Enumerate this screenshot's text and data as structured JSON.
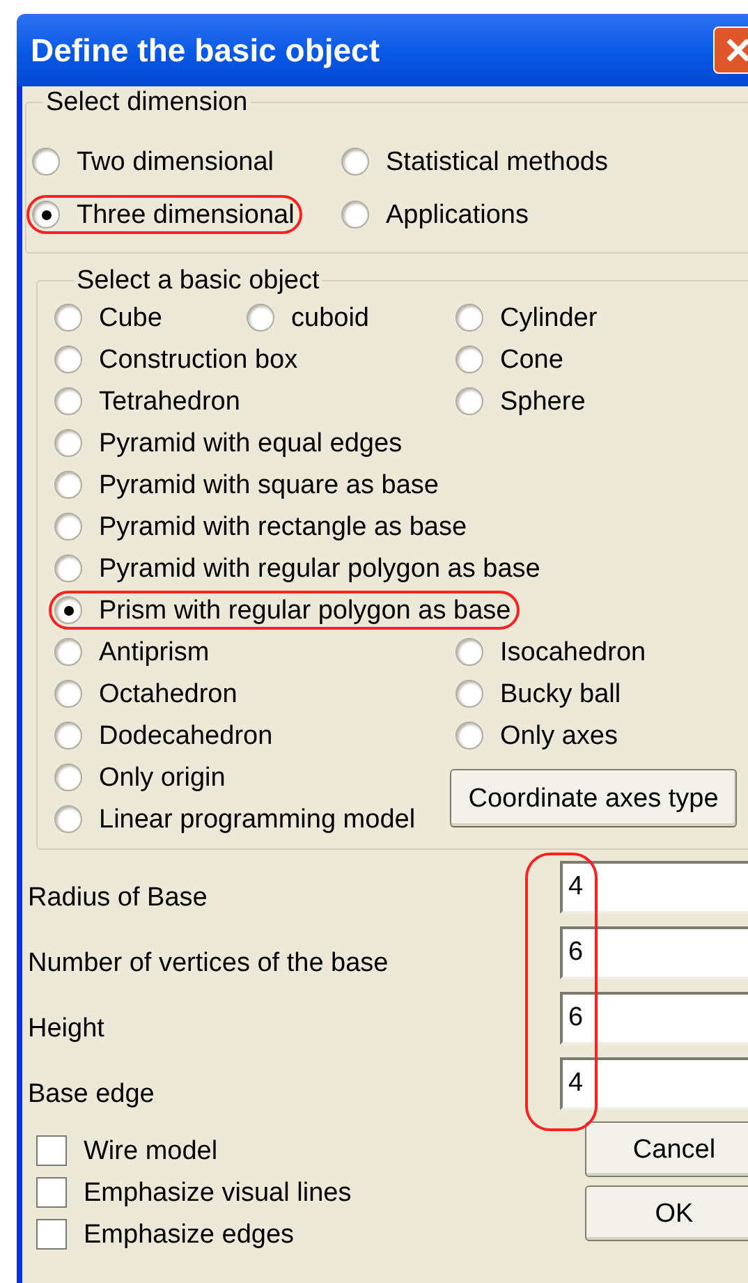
{
  "window": {
    "title": "Define the basic object"
  },
  "dimension_group": {
    "title": "Select dimension",
    "options": [
      {
        "label": "Two dimensional",
        "selected": false,
        "circled": false
      },
      {
        "label": "Statistical methods",
        "selected": false,
        "circled": false
      },
      {
        "label": "Three dimensional",
        "selected": true,
        "circled": true
      },
      {
        "label": "Applications",
        "selected": false,
        "circled": false
      }
    ]
  },
  "object_group": {
    "title": "Select a basic object",
    "rows": [
      {
        "left": {
          "label": "Cube",
          "selected": false,
          "circled": false
        },
        "middle": {
          "label": "cuboid",
          "selected": false,
          "circled": false
        },
        "right": {
          "label": "Cylinder",
          "selected": false,
          "circled": false
        }
      },
      {
        "left": {
          "label": "Construction box",
          "selected": false,
          "circled": false
        },
        "right": {
          "label": "Cone",
          "selected": false,
          "circled": false
        }
      },
      {
        "left": {
          "label": "Tetrahedron",
          "selected": false,
          "circled": false
        },
        "right": {
          "label": "Sphere",
          "selected": false,
          "circled": false
        }
      },
      {
        "left": {
          "label": "Pyramid with equal edges",
          "selected": false,
          "circled": false
        }
      },
      {
        "left": {
          "label": "Pyramid with square as base",
          "selected": false,
          "circled": false
        }
      },
      {
        "left": {
          "label": "Pyramid with rectangle as base",
          "selected": false,
          "circled": false
        }
      },
      {
        "left": {
          "label": "Pyramid with regular polygon as base",
          "selected": false,
          "circled": false
        }
      },
      {
        "left": {
          "label": "Prism with regular polygon as base",
          "selected": true,
          "circled": true
        }
      },
      {
        "left": {
          "label": "Antiprism",
          "selected": false,
          "circled": false
        },
        "right": {
          "label": "Isocahedron",
          "selected": false,
          "circled": false
        }
      },
      {
        "left": {
          "label": "Octahedron",
          "selected": false,
          "circled": false
        },
        "right": {
          "label": "Bucky ball",
          "selected": false,
          "circled": false
        }
      },
      {
        "left": {
          "label": "Dodecahedron",
          "selected": false,
          "circled": false
        },
        "right": {
          "label": "Only axes",
          "selected": false,
          "circled": false
        }
      },
      {
        "left": {
          "label": "Only origin",
          "selected": false,
          "circled": false
        }
      },
      {
        "left": {
          "label": "Linear programming model",
          "selected": false,
          "circled": false
        }
      }
    ],
    "axes_button": "Coordinate axes type"
  },
  "fields": {
    "circled": true,
    "items": [
      {
        "label": "Radius of Base",
        "value": "4"
      },
      {
        "label": "Number of vertices of the base",
        "value": "6"
      },
      {
        "label": "Height",
        "value": "6"
      },
      {
        "label": "Base edge",
        "value": "4"
      }
    ]
  },
  "checkboxes": [
    {
      "label": "Wire model",
      "checked": false
    },
    {
      "label": "Emphasize visual lines",
      "checked": false
    },
    {
      "label": "Emphasize edges",
      "checked": false
    }
  ],
  "buttons": [
    "Cancel",
    "OK"
  ]
}
